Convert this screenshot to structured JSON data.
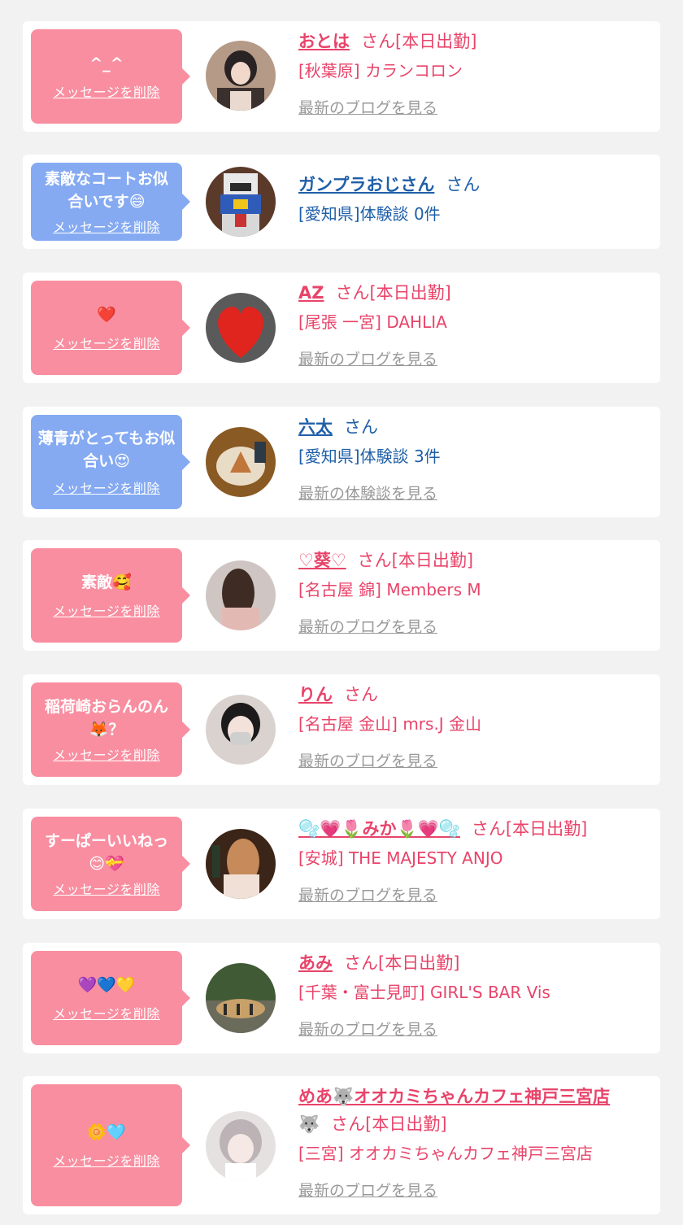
{
  "delete_label": "メッセージを削除",
  "cards": [
    {
      "message": "^_^",
      "bubble": "pink",
      "name": "おとは",
      "suffix": "さん[本日出勤]",
      "shop": "[秋葉原] カランコロン",
      "link": "最新のブログを見る",
      "theme": "pink"
    },
    {
      "message": "素敵なコートお似合いです😄",
      "bubble": "blue",
      "name": "ガンプラおじさん",
      "suffix": "さん",
      "shop": "[愛知県]体験談 0件",
      "link": "",
      "theme": "blue"
    },
    {
      "message": "❤️",
      "bubble": "pink",
      "name": "AZ",
      "suffix": "さん[本日出勤]",
      "shop": "[尾張 一宮] DAHLIA",
      "link": "最新のブログを見る",
      "theme": "pink"
    },
    {
      "message": "薄青がとってもお似合い😍",
      "bubble": "blue",
      "name": "六太",
      "suffix": "さん",
      "shop": "[愛知県]体験談 3件",
      "link": "最新の体験談を見る",
      "theme": "blue"
    },
    {
      "message": "素敵🥰",
      "bubble": "pink",
      "name": "♡葵♡",
      "suffix": "さん[本日出勤]",
      "shop": "[名古屋 錦] Members M",
      "link": "最新のブログを見る",
      "theme": "pink"
    },
    {
      "message": "稲荷崎おらんのん🦊？",
      "bubble": "pink",
      "name": "りん",
      "suffix": "さん",
      "shop": "[名古屋 金山] mrs.J 金山",
      "link": "最新のブログを見る",
      "theme": "pink"
    },
    {
      "message": "すーぱーいいねっ😊💝",
      "bubble": "pink",
      "name": "🫧💗🌷みか🌷💗🫧",
      "suffix": "さん[本日出勤]",
      "shop": "[安城] THE MAJESTY ANJO",
      "link": "最新のブログを見る",
      "theme": "pink"
    },
    {
      "message": "💜💙💛",
      "bubble": "pink",
      "name": "あみ",
      "suffix": "さん[本日出勤]",
      "shop": "[千葉・富士見町] GIRL'S BAR Vis",
      "link": "最新のブログを見る",
      "theme": "pink"
    },
    {
      "message": "🌼🩵",
      "bubble": "pink",
      "name": "めあ🐺オオカミちゃんカフェ神戸三宮店",
      "name_cont": "🐺",
      "suffix": "さん[本日出勤]",
      "shop": "[三宮] オオカミちゃんカフェ神戸三宮店",
      "link": "最新のブログを見る",
      "theme": "pink"
    }
  ]
}
